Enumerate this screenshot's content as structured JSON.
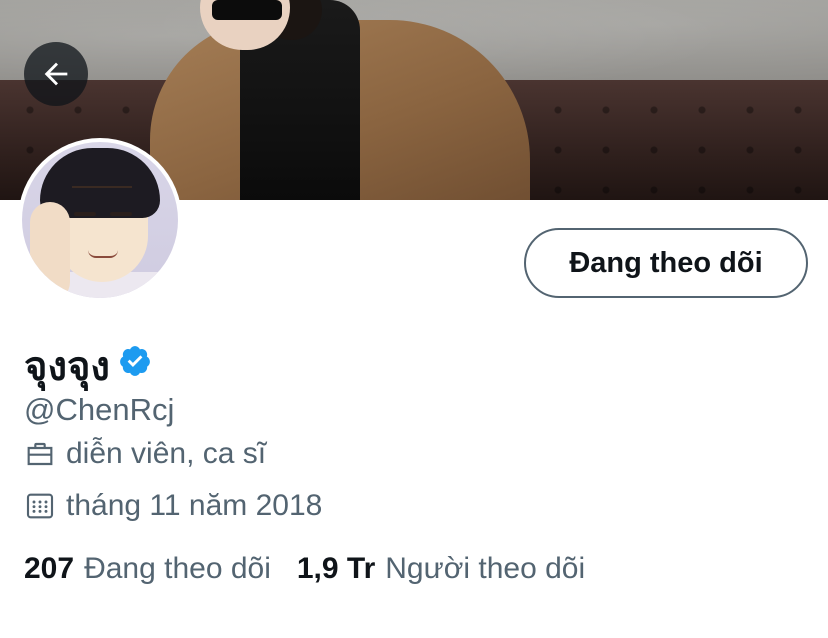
{
  "profile": {
    "display_name": "จุงจุง",
    "verified": true,
    "handle": "@ChenRcj",
    "job": "diễn viên, ca sĩ",
    "joined": "tháng 11 năm 2018",
    "follow_button_label": "Đang theo dõi"
  },
  "stats": {
    "following_count": "207",
    "following_label": "Đang theo dõi",
    "followers_count": "1,9 Tr",
    "followers_label": "Người theo dõi"
  },
  "icons": {
    "back": "arrow-left-icon",
    "verified": "verified-badge-icon",
    "job": "briefcase-icon",
    "joined": "calendar-icon"
  },
  "colors": {
    "text_primary": "#0f1419",
    "text_secondary": "#536471",
    "verified_blue": "#1d9bf0",
    "button_border": "#536471"
  }
}
